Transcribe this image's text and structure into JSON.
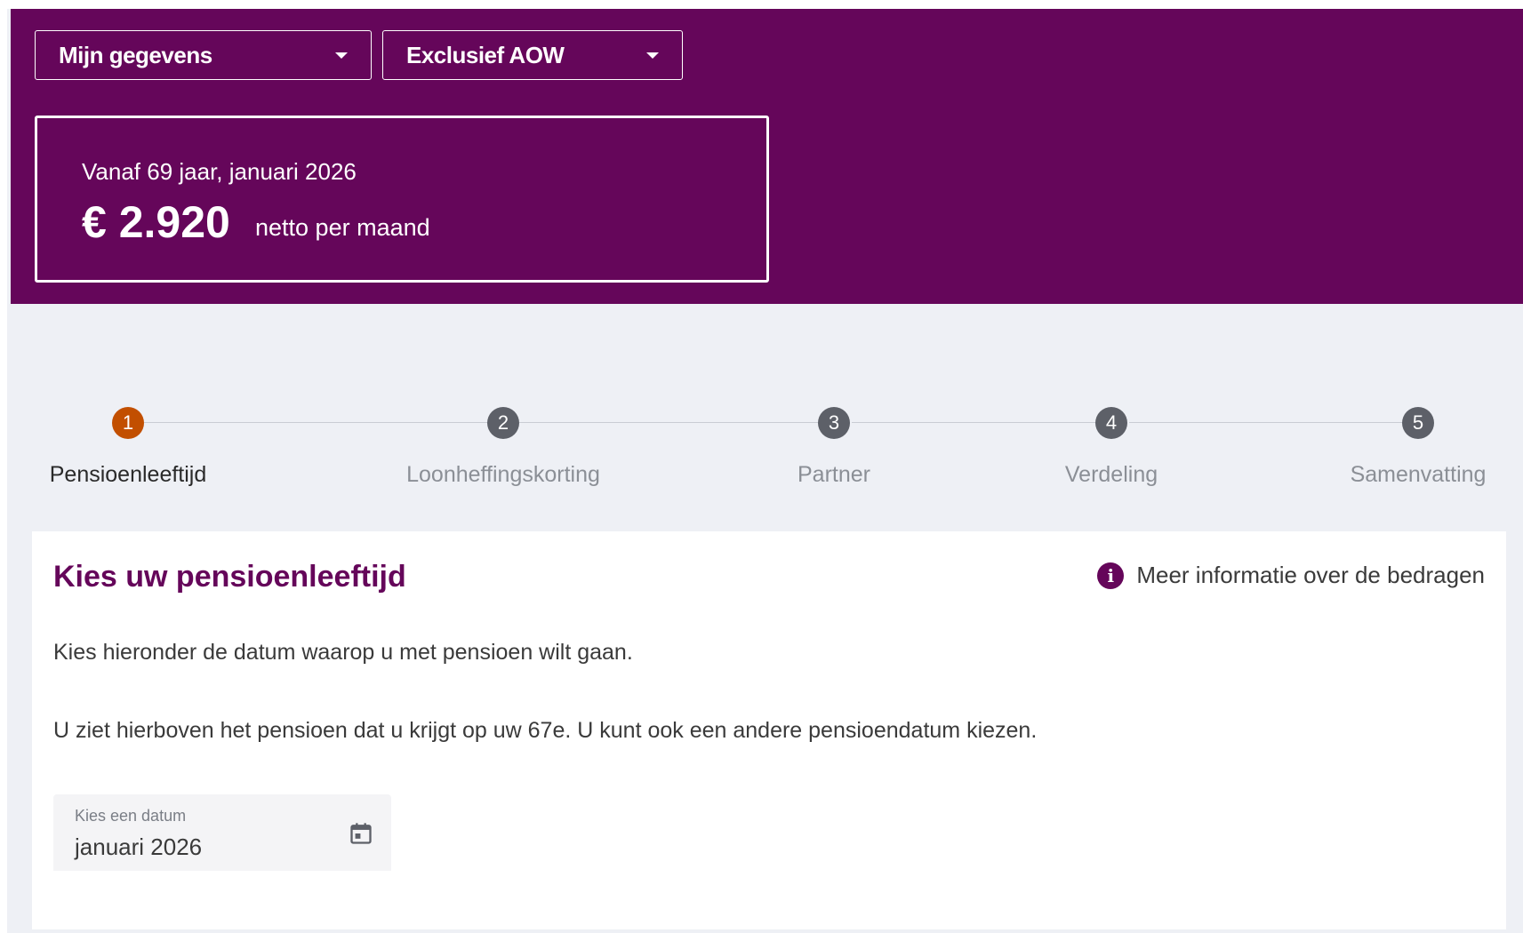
{
  "header": {
    "dropdown_gegevens": "Mijn gegevens",
    "dropdown_aow": "Exclusief AOW",
    "summary": {
      "subtitle": "Vanaf 69 jaar, januari 2026",
      "amount": "€ 2.920",
      "unit": "netto per maand"
    }
  },
  "stepper": {
    "steps": [
      {
        "number": "1",
        "label": "Pensioenleeftijd",
        "active": true
      },
      {
        "number": "2",
        "label": "Loonheffingskorting",
        "active": false
      },
      {
        "number": "3",
        "label": "Partner",
        "active": false
      },
      {
        "number": "4",
        "label": "Verdeling",
        "active": false
      },
      {
        "number": "5",
        "label": "Samenvatting",
        "active": false
      }
    ]
  },
  "main": {
    "title": "Kies uw pensioenleeftijd",
    "info_link": "Meer informatie over de bedragen",
    "paragraph1": "Kies hieronder de datum waarop u met pensioen wilt gaan.",
    "paragraph2": "U ziet hierboven het pensioen dat u krijgt op uw 67e. U kunt ook een andere pensioendatum kiezen.",
    "date_field": {
      "label": "Kies een datum",
      "value": "januari 2026"
    }
  },
  "colors": {
    "brand_purple": "#65065a",
    "active_step": "#c24f00",
    "inactive_step": "#5d6068"
  },
  "icons": [
    "chevron-down-icon",
    "info-icon",
    "calendar-icon"
  ]
}
